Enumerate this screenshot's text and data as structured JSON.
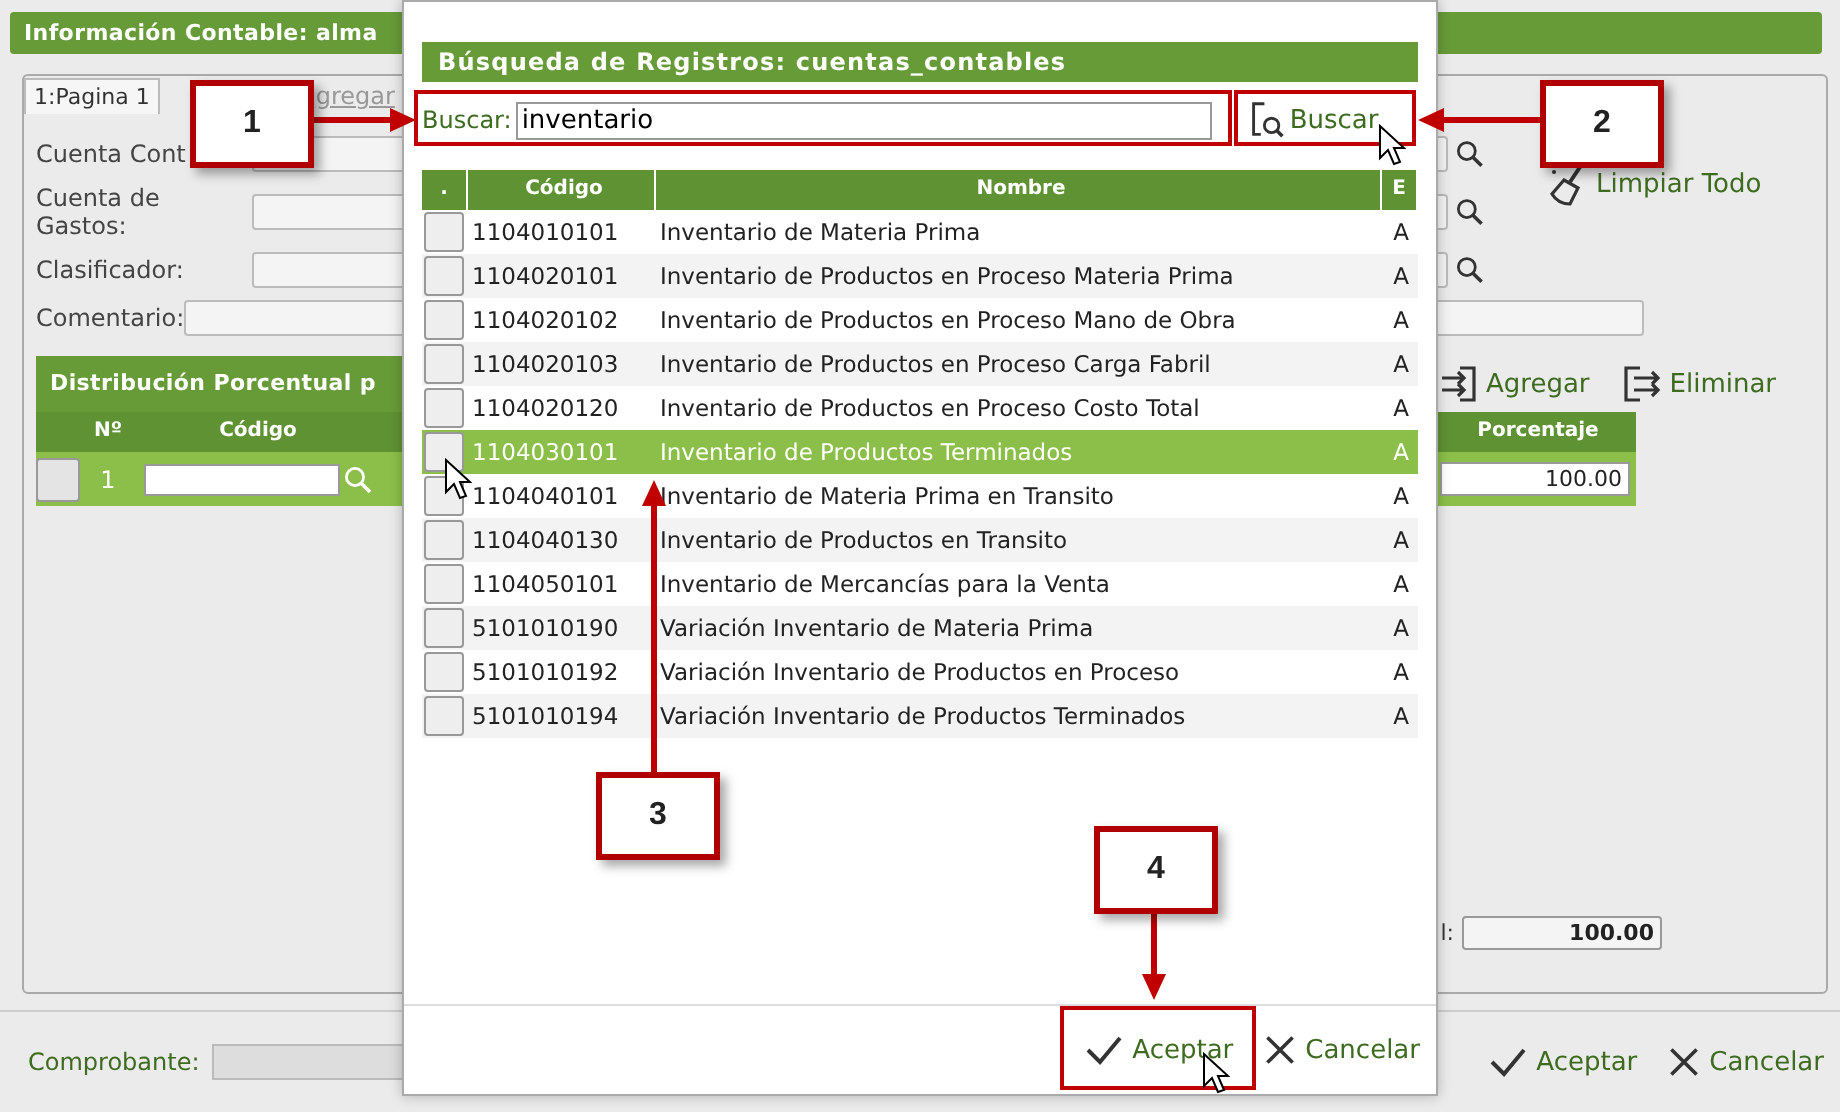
{
  "background_window": {
    "title": "Información Contable: alma",
    "tabs": [
      {
        "label": "1:Pagina 1",
        "selected": true
      }
    ],
    "add_link": "gregar",
    "fields": [
      {
        "label": "Cuenta Cont",
        "search": true
      },
      {
        "label": "Cuenta de Gastos:",
        "search": true
      },
      {
        "label": "Clasificador:",
        "search": true
      },
      {
        "label": "Comentario:",
        "search": false
      }
    ],
    "clear_button": "Limpiar Todo",
    "distribution": {
      "title": "Distribución Porcentual p",
      "add_button": "Agregar",
      "remove_button": "Eliminar",
      "columns": [
        "Nº",
        "Código",
        "Porcentaje"
      ],
      "rows": [
        {
          "number": "1",
          "percent": "100.00",
          "selected": false
        }
      ],
      "total_label": "l:",
      "total": "100.00"
    },
    "footer": {
      "voucher_label": "Comprobante:",
      "buttons": [
        {
          "kind": "accept",
          "label": "Aceptar"
        },
        {
          "kind": "cancel",
          "label": "Cancelar"
        }
      ]
    }
  },
  "dialog": {
    "title": "Búsqueda de Registros: cuentas_contables",
    "search_label": "Buscar:",
    "search_value": "inventario",
    "search_button": "Buscar",
    "columns": [
      ".",
      "Código",
      "Nombre",
      "E"
    ],
    "rows": [
      {
        "code": "1104010101",
        "name": "Inventario de Materia Prima",
        "state": "A",
        "selected": false
      },
      {
        "code": "1104020101",
        "name": "Inventario de Productos en Proceso Materia Prima",
        "state": "A",
        "selected": false
      },
      {
        "code": "1104020102",
        "name": "Inventario de Productos en Proceso Mano de Obra",
        "state": "A",
        "selected": false
      },
      {
        "code": "1104020103",
        "name": "Inventario de Productos en Proceso Carga Fabril",
        "state": "A",
        "selected": false
      },
      {
        "code": "1104020120",
        "name": "Inventario de Productos en Proceso Costo Total",
        "state": "A",
        "selected": false
      },
      {
        "code": "1104030101",
        "name": "Inventario de Productos Terminados",
        "state": "A",
        "selected": true
      },
      {
        "code": "1104040101",
        "name": "Inventario de Materia Prima en Transito",
        "state": "A",
        "selected": false
      },
      {
        "code": "1104040130",
        "name": "Inventario de Productos en Transito",
        "state": "A",
        "selected": false
      },
      {
        "code": "1104050101",
        "name": "Inventario de Mercancías para la Venta",
        "state": "A",
        "selected": false
      },
      {
        "code": "5101010190",
        "name": "Variación Inventario de Materia Prima",
        "state": "A",
        "selected": false
      },
      {
        "code": "5101010192",
        "name": "Variación Inventario de Productos en Proceso",
        "state": "A",
        "selected": false
      },
      {
        "code": "5101010194",
        "name": "Variación Inventario de Productos Terminados",
        "state": "A",
        "selected": false
      }
    ],
    "buttons": [
      {
        "kind": "accept",
        "label": "Aceptar"
      },
      {
        "kind": "cancel",
        "label": "Cancelar"
      }
    ]
  },
  "callouts": [
    {
      "number": "1"
    },
    {
      "number": "2"
    },
    {
      "number": "3"
    },
    {
      "number": "4"
    }
  ]
}
